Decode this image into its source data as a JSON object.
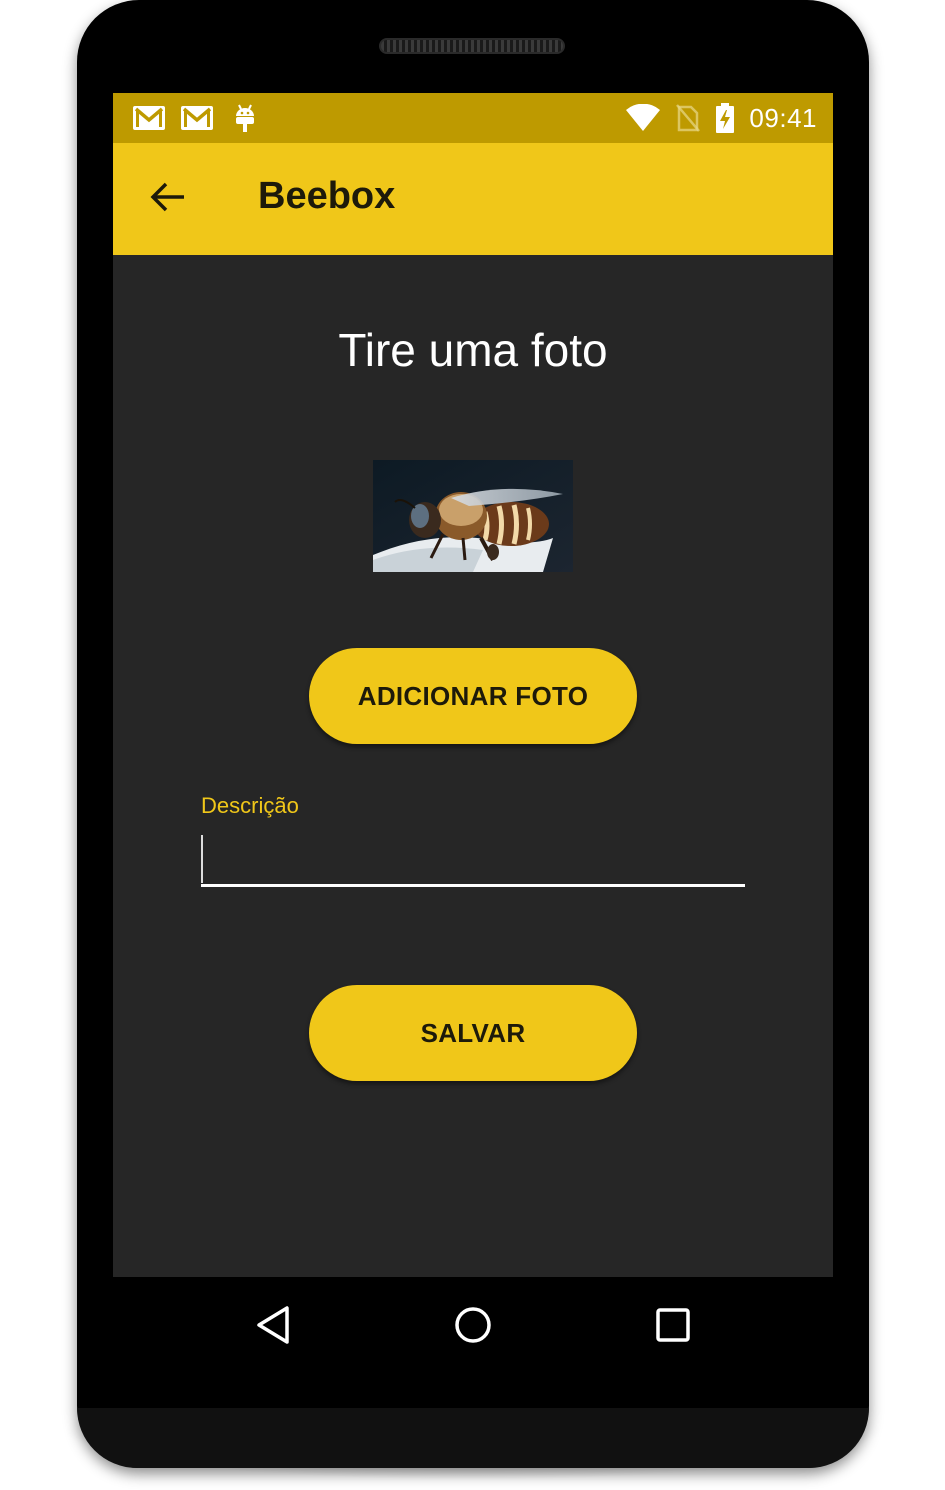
{
  "status_bar": {
    "time": "09:41",
    "left_icons": [
      "gmail-icon",
      "gmail-icon",
      "android-debug-icon"
    ],
    "right_icons": [
      "wifi-icon",
      "no-sim-icon",
      "battery-charging-icon"
    ],
    "background": "#BE9A00"
  },
  "app_bar": {
    "title": "Beebox",
    "back_icon": "arrow-left-icon",
    "background": "#F0C719"
  },
  "main": {
    "heading": "Tire uma foto",
    "photo": {
      "subject": "bee"
    },
    "add_photo_button": "ADICIONAR FOTO",
    "description_field": {
      "label": "Descrição",
      "value": "",
      "placeholder": ""
    },
    "save_button": "SALVAR",
    "background": "#262626"
  },
  "nav_bar": {
    "icons": [
      "nav-back-icon",
      "nav-home-icon",
      "nav-recents-icon"
    ]
  },
  "colors": {
    "accent": "#F0C719",
    "status_bar": "#BE9A00",
    "screen_bg": "#262626"
  }
}
